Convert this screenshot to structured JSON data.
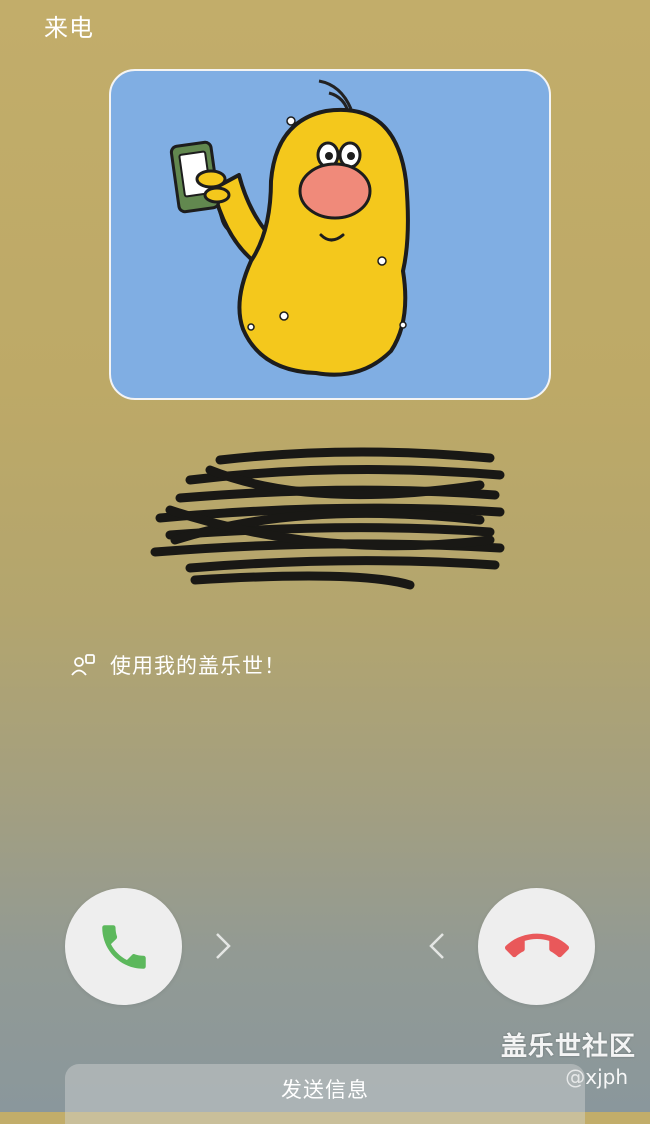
{
  "header": {
    "title": "来电"
  },
  "caller": {
    "avatar": "cartoon-character-holding-phone",
    "card_color": "#80aee3",
    "status_icon": "person-device-icon",
    "status_text": "使用我的盖乐世！"
  },
  "actions": {
    "answer_icon": "phone-answer-icon",
    "answer_color": "#5cb85c",
    "decline_icon": "phone-hangup-icon",
    "decline_color": "#e9585a",
    "send_message_label": "发送信息"
  },
  "watermark": {
    "title": "盖乐世社区",
    "user": "@xjph"
  }
}
